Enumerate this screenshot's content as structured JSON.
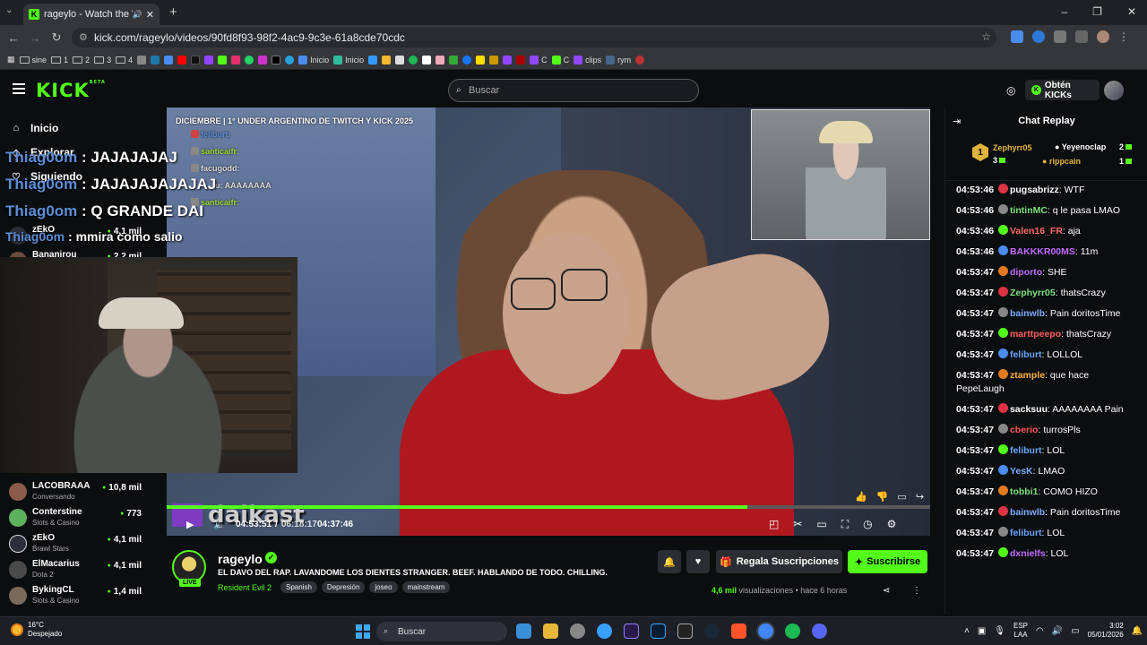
{
  "browser": {
    "tab_title": "rageylo - Watch the VOD o",
    "url": "kick.com/rageylo/videos/90fd8f93-98f2-4ac9-9c3e-61a8cde70cdc",
    "bookmarks": [
      "sine",
      "1",
      "2",
      "3",
      "4",
      "Inicio",
      "Inicio",
      "clips",
      "rym"
    ]
  },
  "header": {
    "logo": "KICK",
    "logo_sup": "BETA",
    "search_placeholder": "Buscar",
    "kicks_label": "Obtén KICKs"
  },
  "sidebar": {
    "nav": [
      {
        "label": "Inicio",
        "icon": "home-icon"
      },
      {
        "label": "Explorar",
        "icon": "compass-icon"
      },
      {
        "label": "Siguiendo",
        "icon": "heart-icon"
      }
    ],
    "channels_top": [
      {
        "name": "zEkO",
        "views": "4,1 mil"
      },
      {
        "name": "Bananirou",
        "views": "2,2 mil"
      }
    ],
    "channels": [
      {
        "name": "LACOBRAAA",
        "category": "Conversando",
        "views": "10,8 mil",
        "color": "#8a5a4a"
      },
      {
        "name": "Conterstine",
        "category": "Slots & Casino",
        "views": "773",
        "color": "#5db05d"
      },
      {
        "name": "zEkO",
        "category": "Brawl Stars",
        "views": "4,1 mil",
        "color": "#2a2f3a"
      },
      {
        "name": "ElMacarius",
        "category": "Dota 2",
        "views": "4,1 mil",
        "color": "#4a4a4a"
      },
      {
        "name": "BykingCL",
        "category": "Slots & Casino",
        "views": "1,4 mil",
        "color": "#7a6a5a"
      }
    ]
  },
  "overlay_chat": [
    {
      "user": "Thiag0om",
      "text": ": JAJAJAJAJ"
    },
    {
      "user": "Thiag0om",
      "text": ": JAJAJAJAJAJAJ"
    },
    {
      "user": "Thiag0om",
      "text": ": Q GRANDE DAI"
    },
    {
      "user": "Thiag0om",
      "text": ": mmira como salio"
    }
  ],
  "video": {
    "title_overlay": "DICIEMBRE | 1° UNDER ARGENTINO DE TWITCH Y KICK 2025",
    "stream_chat": [
      {
        "user": "feliburt:",
        "color": "#5d8ed6"
      },
      {
        "user": "santicaifr:",
        "color": "#9ddc3a"
      },
      {
        "user": "facugodd:",
        "color": "#dddddd"
      },
      {
        "user": "u: AAAAAAAA",
        "color": "#dddddd"
      },
      {
        "user": "santicaifr:",
        "color": "#9ddc3a"
      }
    ],
    "caster": "daikast",
    "progress": 0.76,
    "current_time": "04:53:51",
    "total_time": "06:18:17",
    "remaining": "04:37:46"
  },
  "stream": {
    "name": "rageylo",
    "title": "EL DAVO DEL RAP. LAVANDOME LOS DIENTES STRANGER. BEEF. HABLANDO DE TODO. CHILLING.",
    "live_label": "LIVE",
    "game": "Resident Evil 2",
    "tags": [
      "Spanish",
      "Depresión",
      "joseo",
      "mainstream"
    ],
    "gift_label": "Regala Suscripciones",
    "subscribe_label": "Suscribirse",
    "views": "4,6 mil",
    "views_suffix": "visualizaciones",
    "age": "hace 6 horas"
  },
  "chat": {
    "title": "Chat Replay",
    "leaders": [
      {
        "rank": "1",
        "name": "Zephyrr05",
        "count": "3"
      },
      {
        "name": "Yeyenoclap",
        "count": "2"
      },
      {
        "name": "rippcain",
        "count": "1"
      }
    ],
    "messages": [
      {
        "time": "04:53:46",
        "user": "pugsabrizz",
        "color": "#ffffff",
        "text": "WTF"
      },
      {
        "time": "04:53:46",
        "user": "tintinMC",
        "color": "#7ee07e",
        "text": "q le pasa LMAO"
      },
      {
        "time": "04:53:46",
        "user": "Valen16_FR",
        "color": "#ff6b6b",
        "text": "aja"
      },
      {
        "time": "04:53:46",
        "user": "BAKKKR00MS",
        "color": "#c36bff",
        "text": "11m"
      },
      {
        "time": "04:53:47",
        "user": "diporto",
        "color": "#c06bff",
        "text": "SHE"
      },
      {
        "time": "04:53:47",
        "user": "Zephyrr05",
        "color": "#7ee07e",
        "text": "thatsCrazy"
      },
      {
        "time": "04:53:47",
        "user": "bainwlb",
        "color": "#7eaaff",
        "text": "Pain doritosTime"
      },
      {
        "time": "04:53:47",
        "user": "marttpeepo",
        "color": "#ff6060",
        "text": "thatsCrazy"
      },
      {
        "time": "04:53:47",
        "user": "feliburt",
        "color": "#6ba6ff",
        "text": "LOLLOL"
      },
      {
        "time": "04:53:47",
        "user": "ztample",
        "color": "#ffae42",
        "text": "que hace PepeLaugh"
      },
      {
        "time": "04:53:47",
        "user": "sacksuu",
        "color": "#ffffff",
        "text": "AAAAAAAA Pain"
      },
      {
        "time": "04:53:47",
        "user": "cberio",
        "color": "#ff5555",
        "text": "turrosPls"
      },
      {
        "time": "04:53:47",
        "user": "feliburt",
        "color": "#6ba6ff",
        "text": "LOL"
      },
      {
        "time": "04:53:47",
        "user": "YesK",
        "color": "#7eaaff",
        "text": "LMAO"
      },
      {
        "time": "04:53:47",
        "user": "tobbi1",
        "color": "#7ee07e",
        "text": "COMO HIZO"
      },
      {
        "time": "04:53:47",
        "user": "bainwlb",
        "color": "#7eaaff",
        "text": "Pain doritosTime"
      },
      {
        "time": "04:53:47",
        "user": "feliburt",
        "color": "#6ba6ff",
        "text": "LOL"
      },
      {
        "time": "04:53:47",
        "user": "dxnielfs",
        "color": "#c36bff",
        "text": "LOL"
      }
    ]
  },
  "taskbar": {
    "temp": "16°C",
    "weather": "Despejado",
    "search_label": "Buscar",
    "lang1": "ESP",
    "lang2": "LAA",
    "time": "3:02",
    "date": "05/01/2026"
  }
}
